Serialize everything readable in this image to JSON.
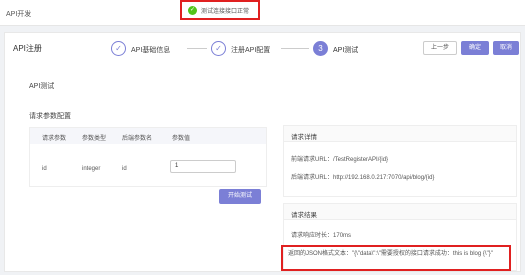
{
  "header": {
    "module": "API开发"
  },
  "toast": {
    "text": "测试连接接口正常"
  },
  "page": {
    "title": "API注册"
  },
  "steps": [
    {
      "number": "1",
      "label": "API基础信息",
      "icon": "check-icon"
    },
    {
      "number": "2",
      "label": "注册API配置",
      "icon": "check-icon"
    },
    {
      "number": "3",
      "label": "API测试",
      "icon": ""
    }
  ],
  "toolbar": {
    "prev_label": "上一步",
    "ok_label": "确定",
    "cancel_label": "取消"
  },
  "test": {
    "section_title": "API测试",
    "params_title": "请求参数配置",
    "columns": [
      "请求参数",
      "参数类型",
      "后端参数名",
      "参数值"
    ],
    "row": {
      "param": "id",
      "type": "integer",
      "backend": "id",
      "value": "1"
    },
    "start_label": "开始测试"
  },
  "details": {
    "title": "请求详情",
    "frontend_url_label": "前端请求URL：",
    "frontend_url": "/TestRegisterAPI/{id}",
    "backend_url_label": "后端请求URL：",
    "backend_url": "http://192.168.0.217:7070/api/blog/{id}"
  },
  "result": {
    "title": "请求结果",
    "duration_label": "请求响应时长：",
    "duration": "170ms",
    "response_label": "返回的JSON格式文本：",
    "response_text": "\"{\\\"data\\\":\\\"需要授权的接口请求成功：this is blog {\\\"}\""
  },
  "colors": {
    "accent": "#7b7fd6",
    "highlight": "#e02020",
    "success": "#52c41a"
  }
}
